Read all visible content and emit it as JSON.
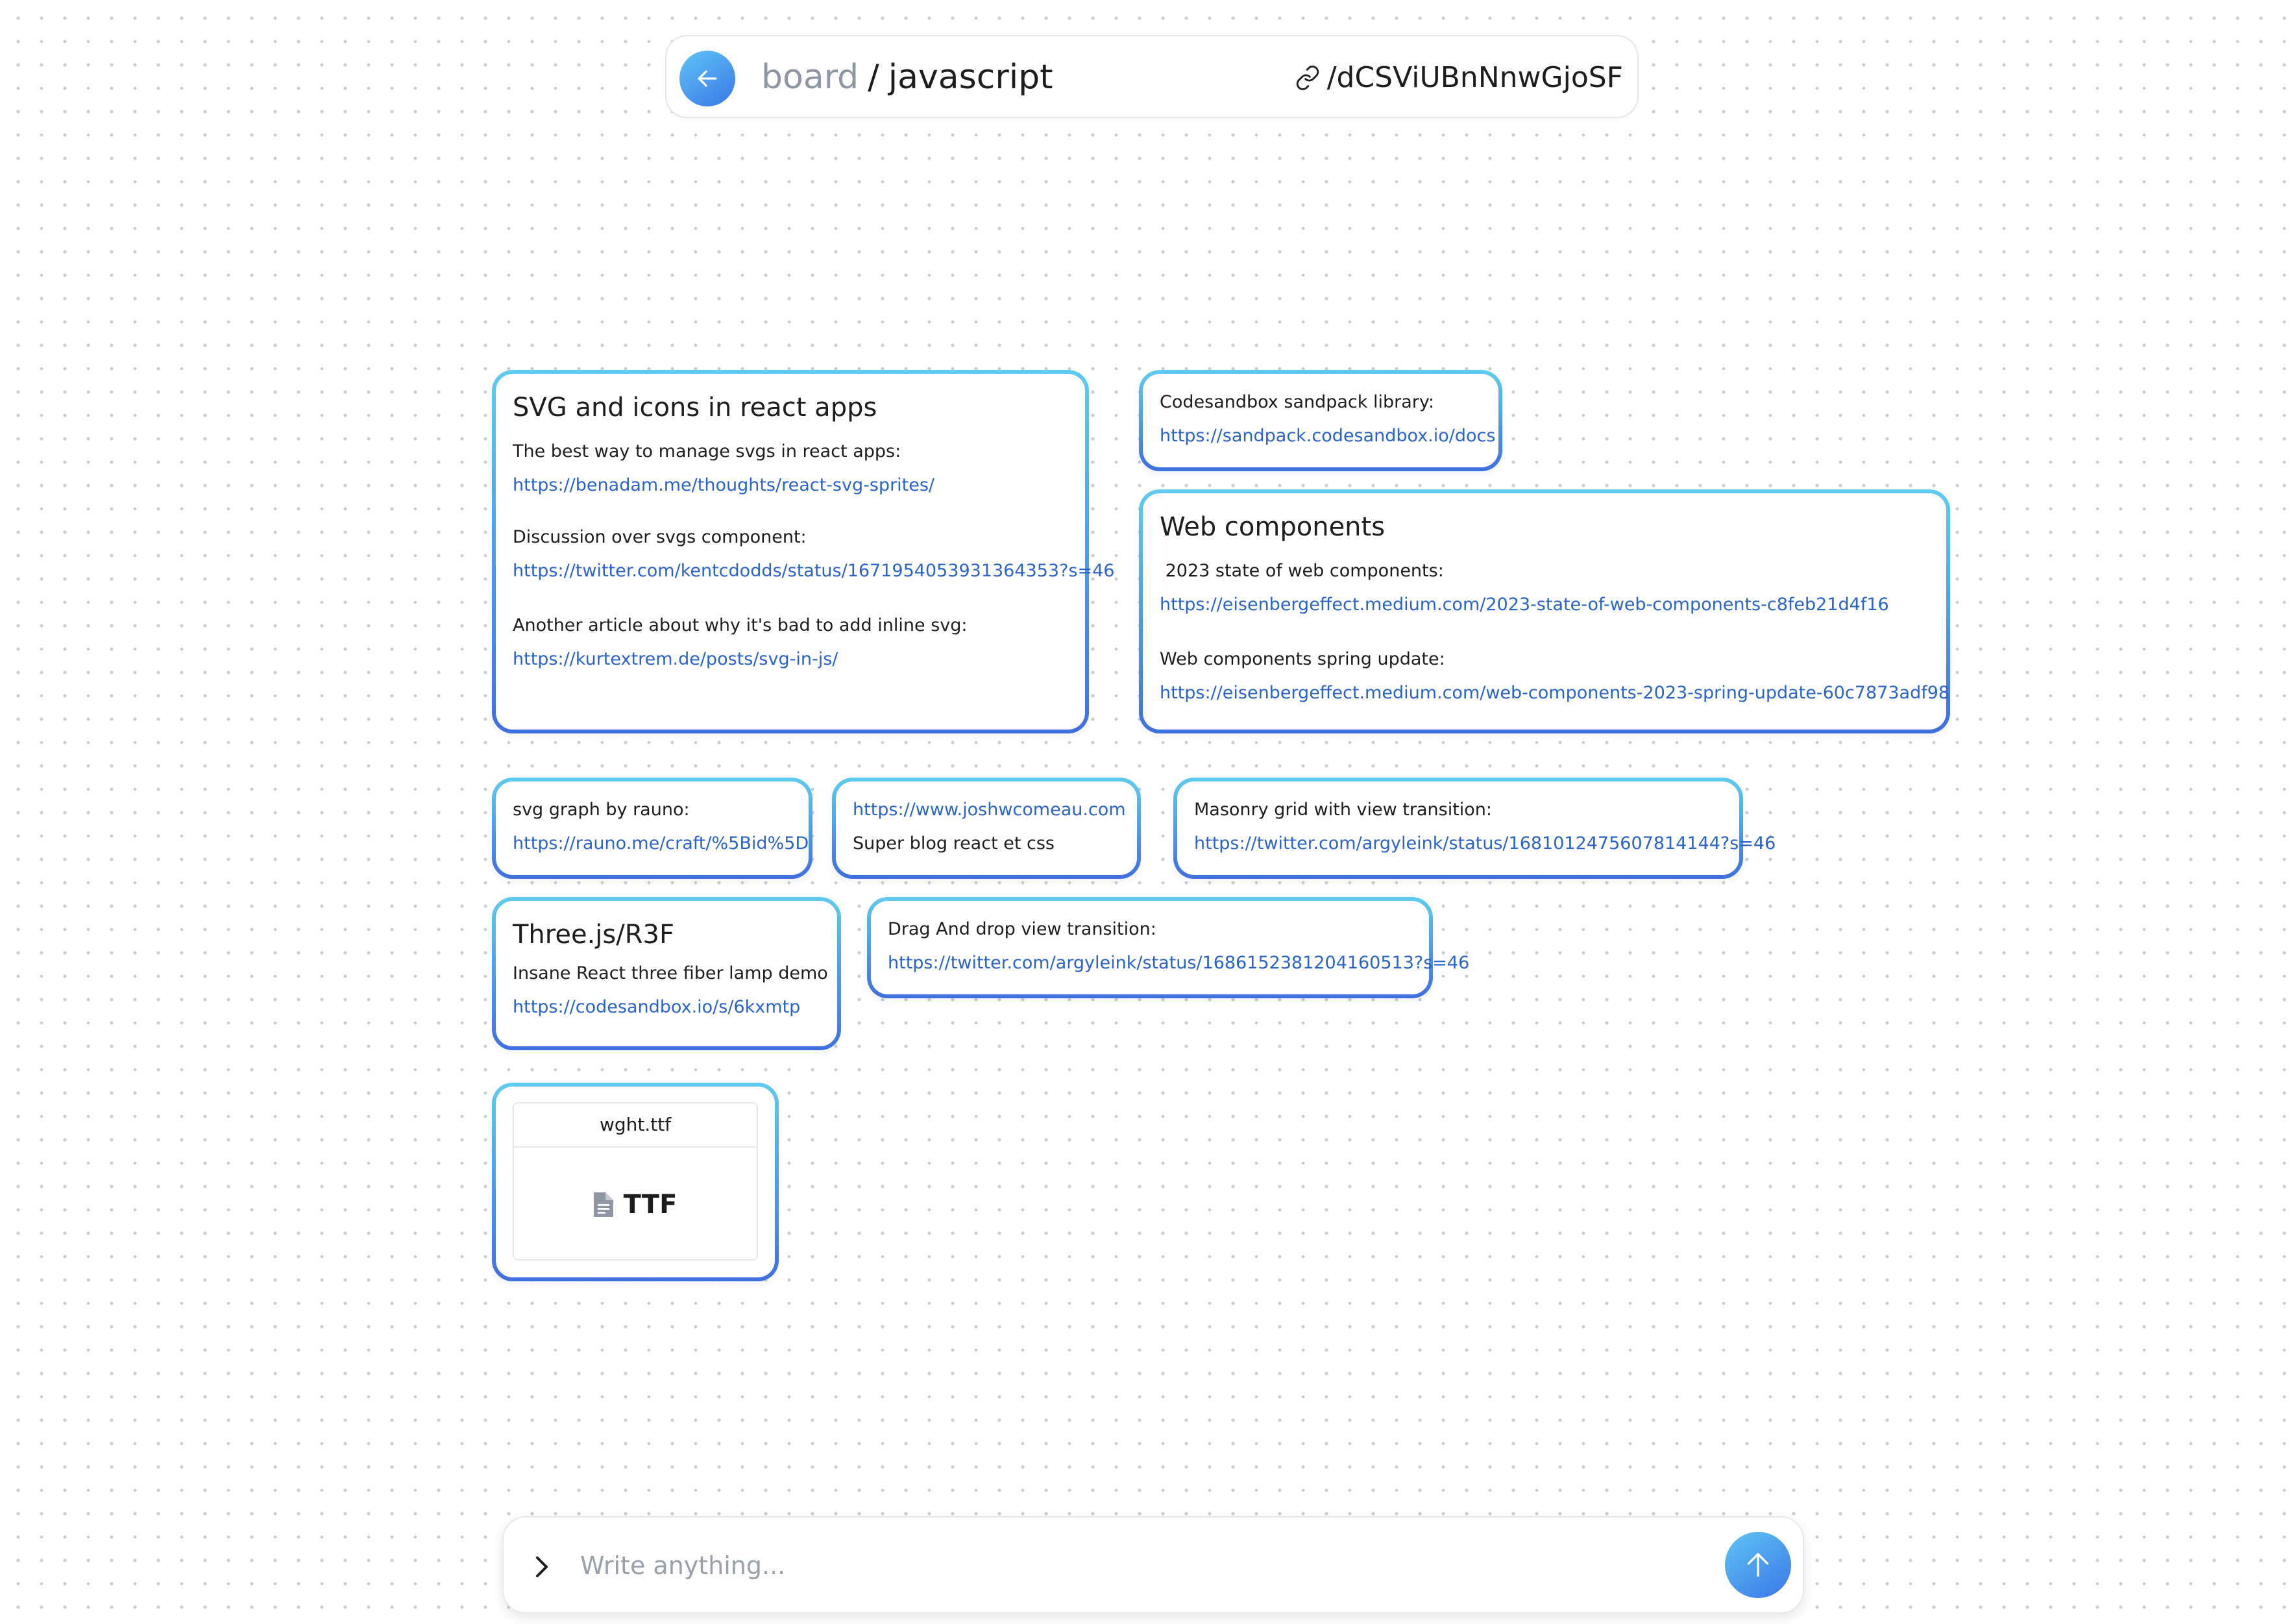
{
  "header": {
    "board_label": "board",
    "separator": "/",
    "board_name": "javascript",
    "board_id": "/dCSViUBnNnwGjoSF"
  },
  "cards": {
    "svg_icons": {
      "title": "SVG and icons in react apps",
      "line1": "The best way to manage svgs in react apps:",
      "link1": "https://benadam.me/thoughts/react-svg-sprites/",
      "line2": "Discussion over svgs component:",
      "link2": "https://twitter.com/kentcdodds/status/1671954053931364353?s=46",
      "line3": "Another article about why it's bad to add inline svg:",
      "link3": "https://kurtextrem.de/posts/svg-in-js/"
    },
    "sandpack": {
      "line1": "Codesandbox sandpack library:",
      "link1": "https://sandpack.codesandbox.io/docs"
    },
    "web_components": {
      "title": "Web components",
      "line1": " 2023 state of web components:",
      "link1": "https://eisenbergeffect.medium.com/2023-state-of-web-components-c8feb21d4f16",
      "line2": "Web components spring update:",
      "link2": "https://eisenbergeffect.medium.com/web-components-2023-spring-update-60c7873adf98"
    },
    "svg_graph": {
      "line1": "svg graph by rauno:",
      "link1": "https://rauno.me/craft/%5Bid%5D"
    },
    "joshw": {
      "link1": "https://www.joshwcomeau.com",
      "line1": "Super blog react et css"
    },
    "masonry": {
      "line1": "Masonry grid with view transition:",
      "link1": "https://twitter.com/argyleink/status/1681012475607814144?s=46"
    },
    "threejs": {
      "title": "Three.js/R3F",
      "line1": "Insane React three fiber lamp demo",
      "link1": "https://codesandbox.io/s/6kxmtp"
    },
    "dragdrop": {
      "line1": "Drag And drop view transition:",
      "link1": "https://twitter.com/argyleink/status/1686152381204160513?s=46"
    },
    "file": {
      "name": "wght.ttf",
      "ext": "TTF",
      "icon": "file-icon"
    }
  },
  "composer": {
    "placeholder": "Write anything...",
    "value": ""
  },
  "colors": {
    "accent_start": "#5fc5f5",
    "accent_end": "#3b76e8",
    "link": "#2a63c9",
    "muted": "#8e95a3"
  }
}
